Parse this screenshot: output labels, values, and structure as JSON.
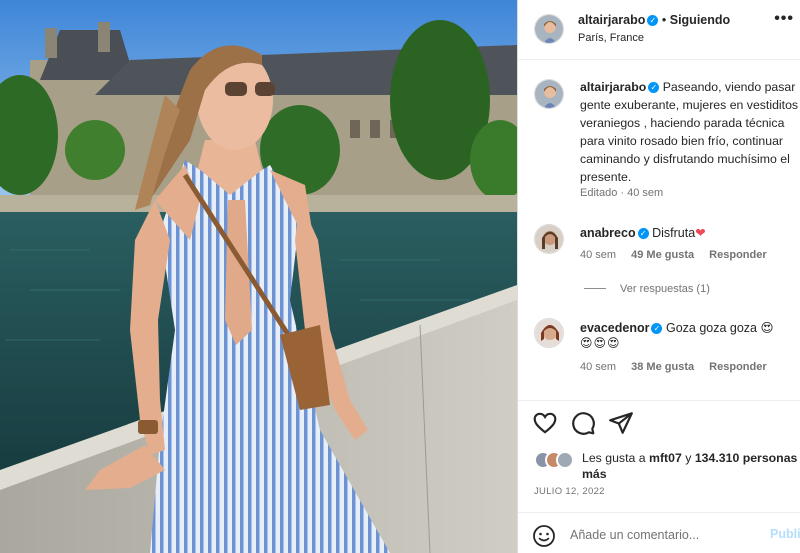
{
  "post": {
    "username": "altairjarabo",
    "follow_status": "Siguiendo",
    "location": "París, France",
    "more_label": "•••"
  },
  "caption": {
    "username": "altairjarabo",
    "text": "Paseando, viendo pasar gente exuberante, mujeres en vestiditos veraniegos , haciendo parada técnica para vinito rosado bien frío, continuar caminando y disfrutando muchísimo el presente.",
    "meta": "Editado · 40 sem"
  },
  "comments": [
    {
      "username": "anabreco",
      "text": "Disfruta",
      "emoji": "❤",
      "age": "40 sem",
      "likes": "49 Me gusta",
      "reply": "Responder",
      "view_replies": "Ver respuestas (1)"
    },
    {
      "username": "evacedenor",
      "text": "Goza goza goza",
      "emoji": "😍",
      "emoji_line": "😍😍😍",
      "age": "40 sem",
      "likes": "38 Me gusta",
      "reply": "Responder"
    }
  ],
  "likes": {
    "prefix": "Les gusta a",
    "user": "mft07",
    "middle": "y",
    "others": "134.310 personas",
    "suffix": "más"
  },
  "date": "JULIO 12, 2022",
  "add_comment": {
    "placeholder": "Añade un comentario...",
    "publish_label": "Publicar"
  },
  "icons": {
    "like": "heart-icon",
    "comment": "comment-icon",
    "share": "share-icon",
    "emoji": "emoji-icon",
    "verified": "verified-badge-icon"
  },
  "colors": {
    "verified": "#0095f6",
    "heart": "#ed4956",
    "publish": "#b2dffc",
    "muted_text": "#737373"
  }
}
